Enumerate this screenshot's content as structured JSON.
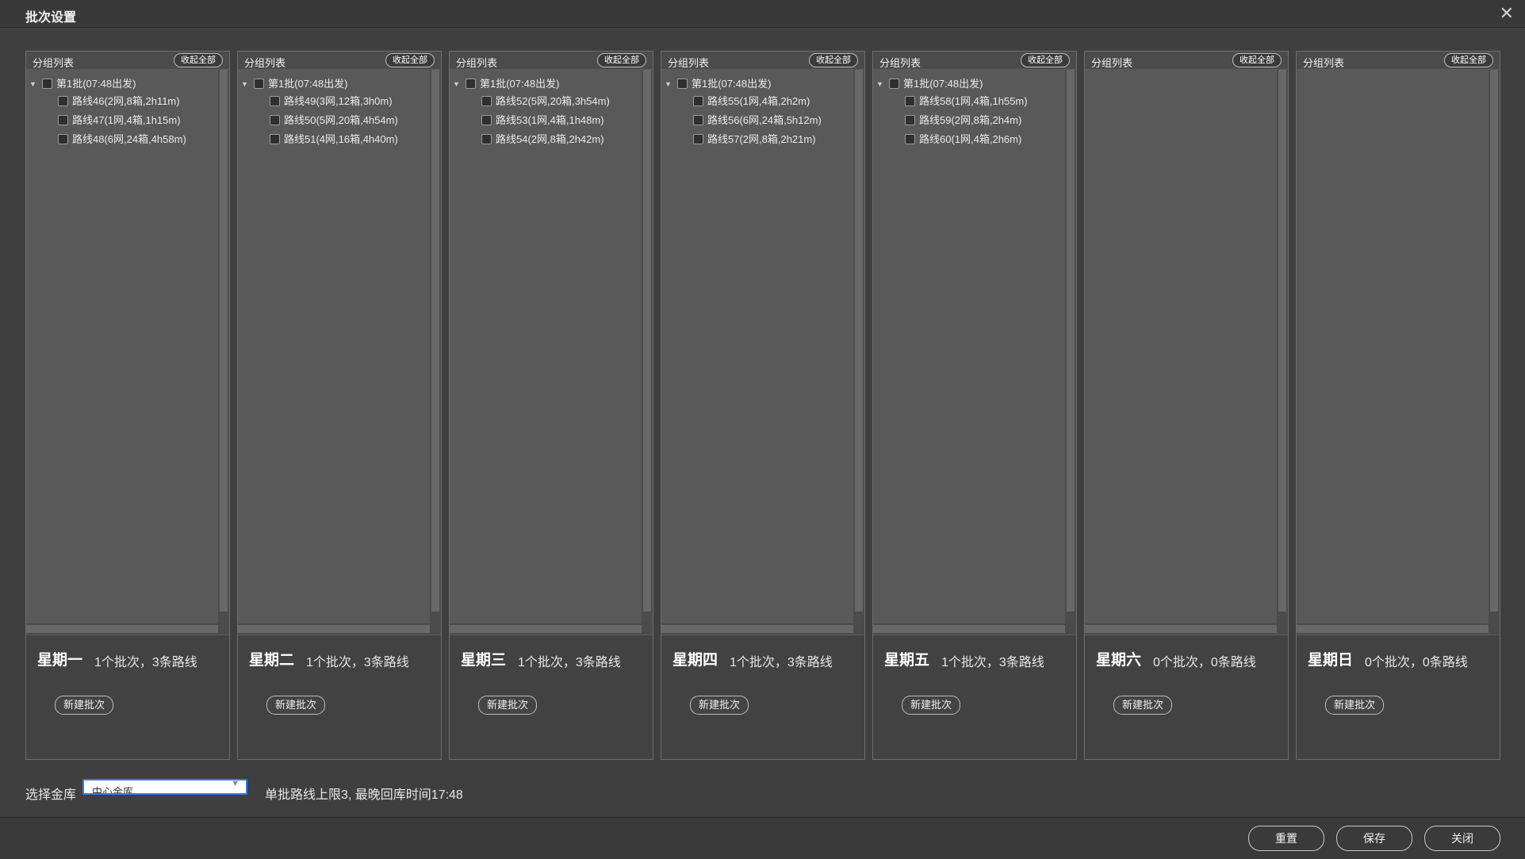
{
  "window": {
    "title": "批次设置",
    "close_icon": "close-icon"
  },
  "columns": [
    {
      "header": "分组列表",
      "collapse_label": "收起全部",
      "batches": [
        {
          "label": "第1批(07:48出发)",
          "routes": [
            "路线46(2网,8箱,2h11m)",
            "路线47(1网,4箱,1h15m)",
            "路线48(6网,24箱,4h58m)"
          ]
        }
      ],
      "day": "星期一",
      "stats": "1个批次，3条路线",
      "new_batch_label": "新建批次"
    },
    {
      "header": "分组列表",
      "collapse_label": "收起全部",
      "batches": [
        {
          "label": "第1批(07:48出发)",
          "routes": [
            "路线49(3网,12箱,3h0m)",
            "路线50(5网,20箱,4h54m)",
            "路线51(4网,16箱,4h40m)"
          ]
        }
      ],
      "day": "星期二",
      "stats": "1个批次，3条路线",
      "new_batch_label": "新建批次"
    },
    {
      "header": "分组列表",
      "collapse_label": "收起全部",
      "batches": [
        {
          "label": "第1批(07:48出发)",
          "routes": [
            "路线52(5网,20箱,3h54m)",
            "路线53(1网,4箱,1h48m)",
            "路线54(2网,8箱,2h42m)"
          ]
        }
      ],
      "day": "星期三",
      "stats": "1个批次，3条路线",
      "new_batch_label": "新建批次"
    },
    {
      "header": "分组列表",
      "collapse_label": "收起全部",
      "batches": [
        {
          "label": "第1批(07:48出发)",
          "routes": [
            "路线55(1网,4箱,2h2m)",
            "路线56(6网,24箱,5h12m)",
            "路线57(2网,8箱,2h21m)"
          ]
        }
      ],
      "day": "星期四",
      "stats": "1个批次，3条路线",
      "new_batch_label": "新建批次"
    },
    {
      "header": "分组列表",
      "collapse_label": "收起全部",
      "batches": [
        {
          "label": "第1批(07:48出发)",
          "routes": [
            "路线58(1网,4箱,1h55m)",
            "路线59(2网,8箱,2h4m)",
            "路线60(1网,4箱,2h6m)"
          ]
        }
      ],
      "day": "星期五",
      "stats": "1个批次，3条路线",
      "new_batch_label": "新建批次"
    },
    {
      "header": "分组列表",
      "collapse_label": "收起全部",
      "batches": [],
      "day": "星期六",
      "stats": "0个批次，0条路线",
      "new_batch_label": "新建批次"
    },
    {
      "header": "分组列表",
      "collapse_label": "收起全部",
      "batches": [],
      "day": "星期日",
      "stats": "0个批次，0条路线",
      "new_batch_label": "新建批次"
    }
  ],
  "warehouse": {
    "label": "选择金库",
    "selected": "中心金库",
    "dropdown_icon": "chevron-down-icon"
  },
  "info_text": "单批路线上限3, 最晚回库时间17:48",
  "footer": {
    "reset_label": "重置",
    "save_label": "保存",
    "close_label": "关闭"
  },
  "colors": {
    "background": "#3f3f3f",
    "panel": "#595959",
    "select_border": "#2d7df6"
  }
}
